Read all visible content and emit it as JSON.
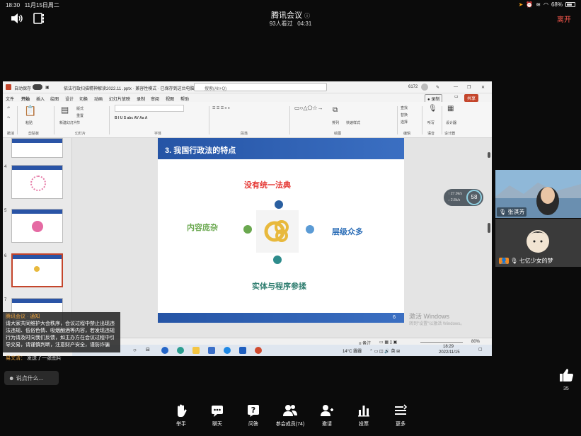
{
  "status_bar": {
    "time": "18:30",
    "date": "11月15日周二",
    "battery": "68%"
  },
  "meeting": {
    "title": "腾讯会议",
    "viewers": "93人看过",
    "duration": "04:31",
    "leave_label": "离开"
  },
  "shared_app": {
    "autosave_label": "自动保存",
    "file_title": "依法行政扫描精神解读2022.11 .pptx · 兼容性模式 · 已保存到这台电脑",
    "search_placeholder": "搜索(Alt+Q)",
    "counter": "6172",
    "record_label": "录制",
    "share_label": "共享",
    "menu": [
      "文件",
      "开始",
      "插入",
      "绘图",
      "设计",
      "切换",
      "动画",
      "幻灯片放映",
      "录制",
      "审阅",
      "视图",
      "帮助"
    ],
    "ribbon_groups": [
      "撤消",
      "剪贴板",
      "幻灯片",
      "字体",
      "段落",
      "绘图",
      "编辑",
      "语音",
      "设计器"
    ],
    "ribbon_items": [
      "粘贴",
      "新建幻灯片",
      "版式",
      "重置",
      "节",
      "排列",
      "快速样式",
      "查找",
      "替换",
      "选择",
      "听写",
      "设计器"
    ],
    "thumb_numbers": [
      "4",
      "5",
      "6",
      "7"
    ],
    "slide": {
      "header": "3. 我国行政法的特点",
      "top_label": "没有统一法典",
      "left_label": "内容庞杂",
      "right_label": "层级众多",
      "bottom_label": "实体与程序参揉",
      "page_number": "6"
    },
    "status_notes": "备注",
    "zoom": "80%",
    "activate_windows": "激活 Windows",
    "activate_hint": "转到\"设置\"以激活 Windows。",
    "taskbar_weather": "14°C 霾霾",
    "taskbar_time": "18:29",
    "taskbar_date": "2022/11/15"
  },
  "speed_widget": {
    "up": "↑ 27.9k/s",
    "down": "↓ 2.8k/s",
    "value": "58"
  },
  "participants": [
    {
      "name": "张淇芳"
    },
    {
      "name": "七亿少女的梦"
    }
  ],
  "notice": {
    "header": "腾讯会议 · 通知",
    "text": "请大家共同维护大会秩序，会议过程中禁止出现违法违规、低俗色情、吸烟酗酒等内容，若发现违规行为请及时向我们反馈，如主办方在会议过程中引导交易，请谨慎判断，注意财产安全，谨防诈骗"
  },
  "chat": {
    "sender": "易文清：",
    "message": "发送了一张图片"
  },
  "input_placeholder": "说点什么...",
  "like_count": "35",
  "toolbar": [
    {
      "label": "举手",
      "icon": "raise-hand-icon"
    },
    {
      "label": "聊天",
      "icon": "chat-icon"
    },
    {
      "label": "问答",
      "icon": "qa-icon"
    },
    {
      "label": "参会成员(74)",
      "icon": "members-icon"
    },
    {
      "label": "邀请",
      "icon": "invite-icon"
    },
    {
      "label": "投票",
      "icon": "vote-icon"
    },
    {
      "label": "更多",
      "icon": "more-icon"
    }
  ],
  "colors": {
    "slide_blue": "#2554a5",
    "label_red": "#e53935",
    "label_green": "#6aa84f",
    "label_blue": "#2e6fb8",
    "label_teal": "#2e7d6f",
    "leave_red": "#ff5a4e"
  }
}
